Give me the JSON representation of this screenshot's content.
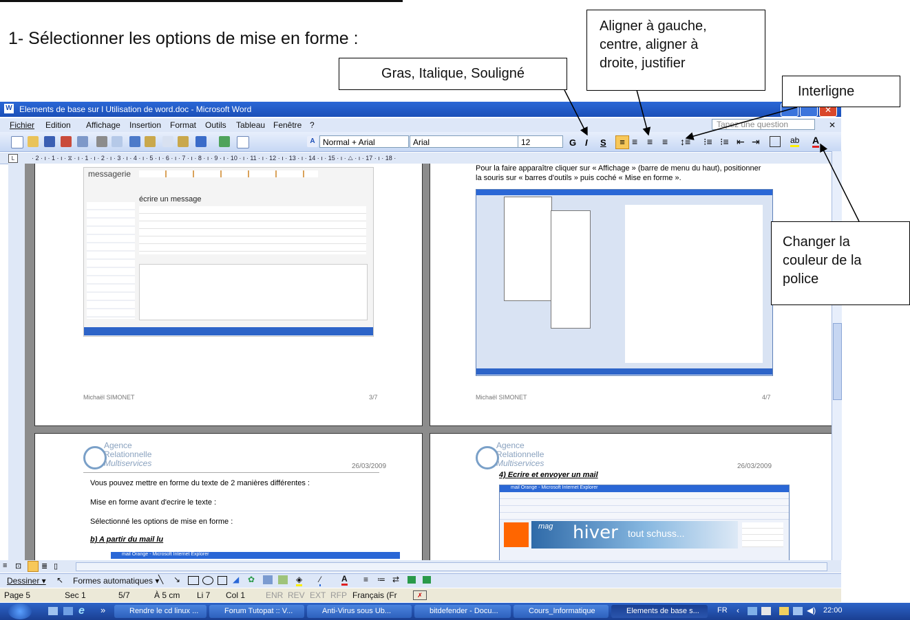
{
  "heading": "1- Sélectionner les options de mise en forme :",
  "callouts": {
    "gras": "Gras, Italique, Souligné",
    "aligner": [
      "Aligner à gauche,",
      "centre, aligner à",
      "droite, justifier"
    ],
    "interligne": "Interligne",
    "couleur": [
      "Changer la",
      "couleur de la",
      "police"
    ]
  },
  "window": {
    "title": "Elements de base sur l Utilisation de word.doc - Microsoft Word",
    "question_placeholder": "Tapez une question",
    "menu": [
      "Fichier",
      "Edition",
      "Affichage",
      "Insertion",
      "Format",
      "Outils",
      "Tableau",
      "Fenêtre",
      "?"
    ],
    "style_value": "Normal + Arial",
    "font_value": "Arial",
    "size_value": "12",
    "ruler_text": "· 2 · ı · 1 · ı · ⧖ · ı · 1 · ı · 2 · ı · 3 · ı · 4 · ı · 5 · ı · 6 · ı · 7 · ı · 8 · ı · 9 · ı · 10 · ı · 11 · ı · 12 · ı · 13 · ı · 14 · ı · 15 · ı · △ · ı · 17 · ı · 18 ·"
  },
  "pages": {
    "p3": {
      "heading": "messagerie",
      "compose": "écrire un message",
      "footer_left": "Michaël SIMONET",
      "footer_right": "3/7"
    },
    "p4": {
      "line1": "Pour la faire apparaître cliquer sur « Affichage » (barre de menu du haut), positionner",
      "line2": "la souris sur « barres d'outils » puis coché « Mise en forme ».",
      "footer_left": "Michaël SIMONET",
      "footer_right": "4/7"
    },
    "p5": {
      "logo": [
        "Agence",
        "Relationnelle",
        "Multiservices"
      ],
      "date": "26/03/2009",
      "lines": [
        "Vous pouvez mettre en forme du texte de 2 manières différentes :",
        "Mise en forme avant d'ecrire le texte :",
        "Sélectionné les options de mise en forme :",
        "b) A partir du mail lu"
      ],
      "ie_title": "mail Orange - Microsoft Internet Explorer"
    },
    "p6": {
      "logo": [
        "Agence",
        "Relationnelle",
        "Multiservices"
      ],
      "date": "26/03/2009",
      "heading": "4) Ecrire et envoyer un mail",
      "ie_title": "mail Orange - Microsoft Internet Explorer",
      "banner_text": "tout schuss...",
      "banner_hiver": "hiver",
      "banner_mag": "mag"
    }
  },
  "drawbar": {
    "dessiner": "Dessiner ▾",
    "formes": "Formes automatiques ▾"
  },
  "status": [
    "Page 5",
    "Sec 1",
    "5/7",
    "À 5 cm",
    "Li 7",
    "Col 1",
    "ENR",
    "REV",
    "EXT",
    "RFP",
    "Français (Fr"
  ],
  "taskbar": {
    "items": [
      "Rendre le cd linux ...",
      "Forum Tutopat :: V...",
      "Anti-Virus sous Ub...",
      "bitdefender - Docu...",
      "Cours_Informatique",
      "Elements de base s..."
    ],
    "lang": "FR",
    "time": "22:00"
  }
}
